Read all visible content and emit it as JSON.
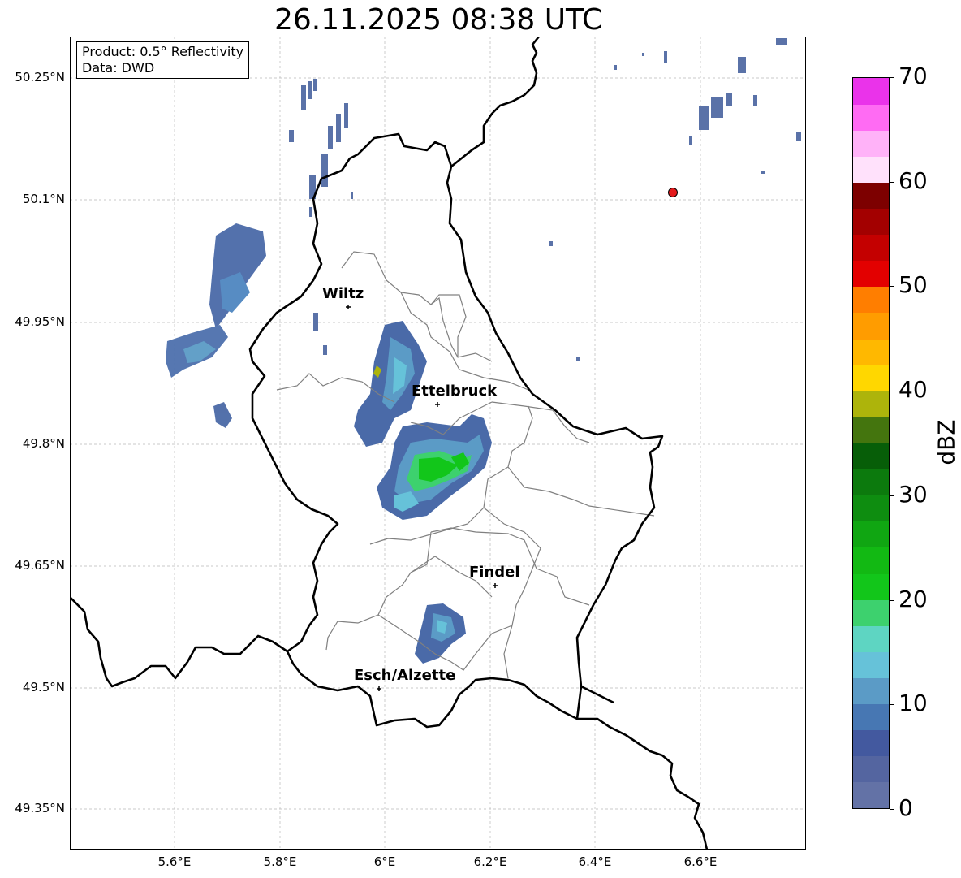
{
  "title": "26.11.2025 08:38 UTC",
  "info": {
    "product": "Product: 0.5° Reflectivity",
    "data": "Data: DWD"
  },
  "lat_ticks": [
    "50.25°N",
    "50.1°N",
    "49.95°N",
    "49.8°N",
    "49.65°N",
    "49.5°N",
    "49.35°N"
  ],
  "lon_ticks": [
    "5.6°E",
    "5.8°E",
    "6°E",
    "6.2°E",
    "6.4°E",
    "6.6°E"
  ],
  "cities": [
    {
      "name": "Wiltz",
      "lat": 49.97,
      "lon": 5.93
    },
    {
      "name": "Ettelbruck",
      "lat": 49.85,
      "lon": 6.1
    },
    {
      "name": "Findel",
      "lat": 49.63,
      "lon": 6.21
    },
    {
      "name": "Esch/Alzette",
      "lat": 49.5,
      "lon": 5.99
    }
  ],
  "radar_site": {
    "lat": 50.11,
    "lon": 6.55,
    "color": "#e41a1c"
  },
  "colorbar": {
    "label": "dBZ",
    "ticks": [
      "0",
      "10",
      "20",
      "30",
      "40",
      "50",
      "60",
      "70"
    ],
    "colors": [
      "#6372a6",
      "#5465a0",
      "#43599f",
      "#4777b3",
      "#5b9bc6",
      "#66c2d9",
      "#5ed5c2",
      "#3dd16e",
      "#12c61a",
      "#12b913",
      "#10a612",
      "#0e8d10",
      "#0c7a0d",
      "#075e08",
      "#44750e",
      "#adb40b",
      "#ffd700",
      "#ffb800",
      "#ff9c00",
      "#ff7e00",
      "#e30000",
      "#c40000",
      "#a30000",
      "#7d0000",
      "#ffe1fb",
      "#ffb2f8",
      "#ff6bf3",
      "#ea33ea"
    ]
  }
}
